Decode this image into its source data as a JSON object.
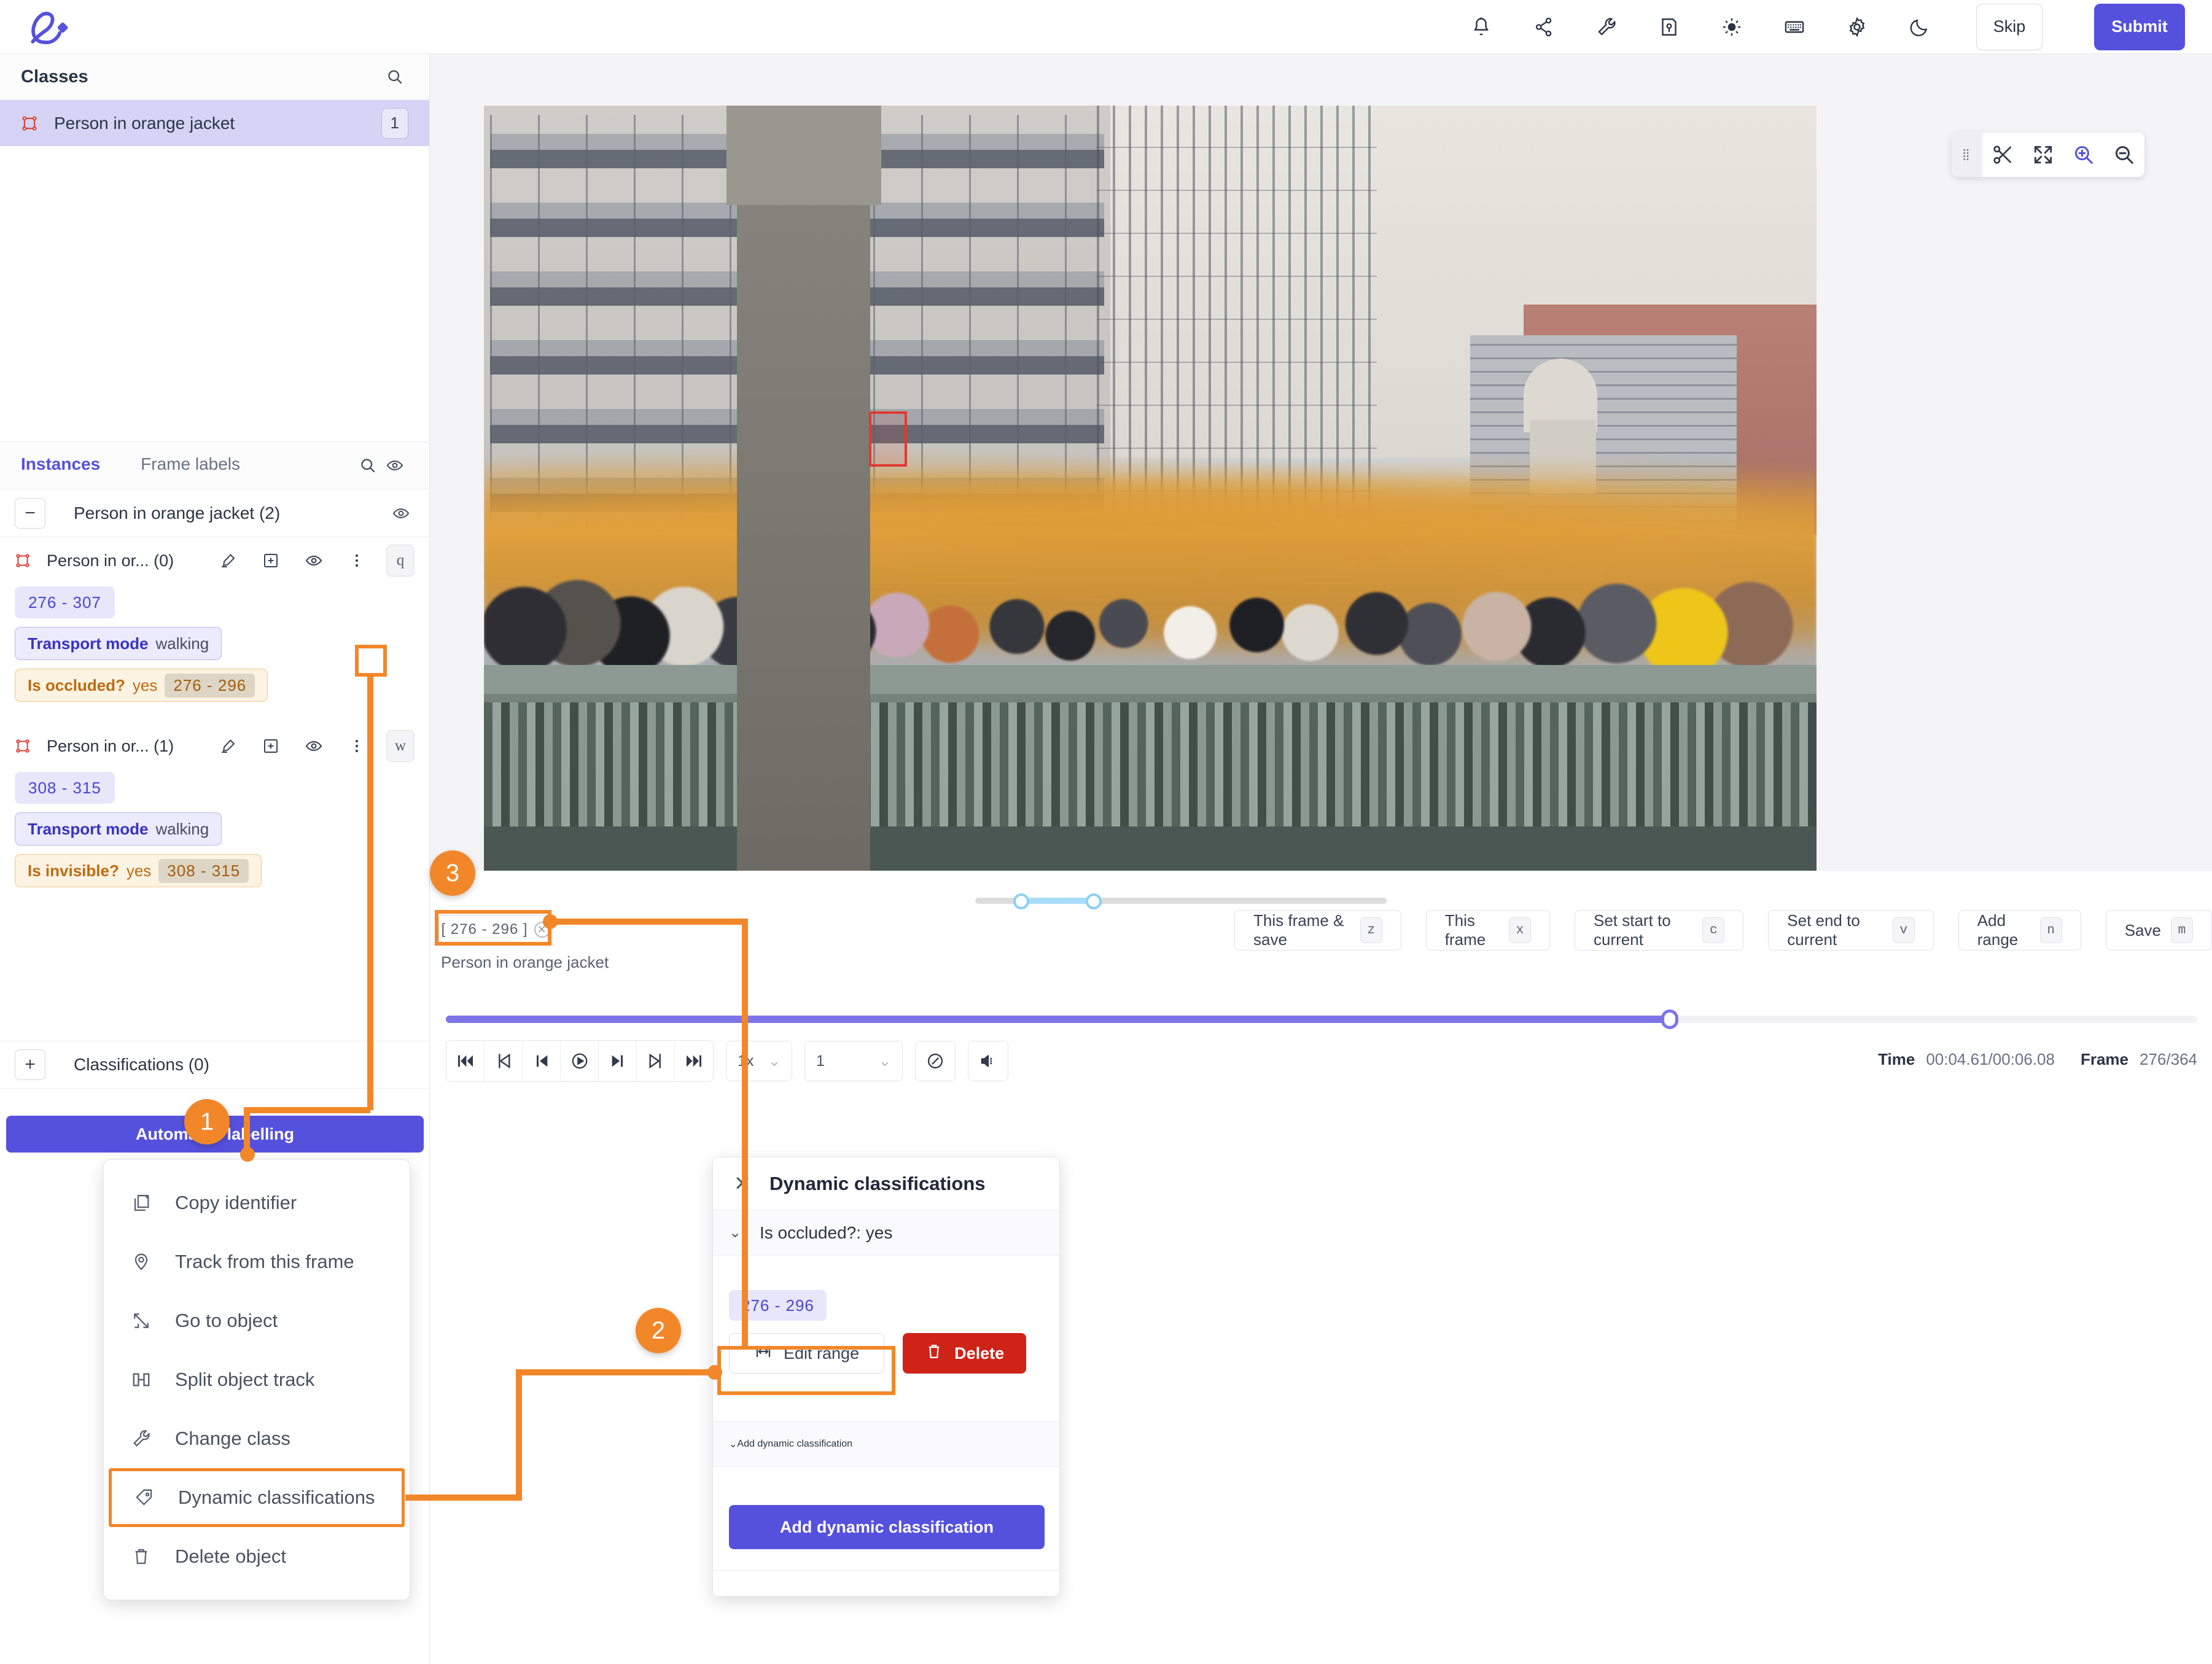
{
  "header": {
    "logo_name": "encord-logo",
    "icons": [
      {
        "name": "bell-icon",
        "label": "Notifications"
      },
      {
        "name": "share-icon",
        "label": "Share"
      },
      {
        "name": "wrench-icon",
        "label": "Tools"
      },
      {
        "name": "save-file-icon",
        "label": "Save"
      },
      {
        "name": "brightness-icon",
        "label": "Brightness"
      },
      {
        "name": "keyboard-icon",
        "label": "Keyboard shortcuts"
      },
      {
        "name": "gear-icon",
        "label": "Settings"
      },
      {
        "name": "moon-icon",
        "label": "Dark mode"
      }
    ],
    "skip_label": "Skip",
    "submit_label": "Submit"
  },
  "sidebar": {
    "classes_title": "Classes",
    "search_icon": "search-icon",
    "classes": [
      {
        "name": "Person in orange jacket",
        "count": "1"
      }
    ],
    "tabs": [
      {
        "label": "Instances",
        "active": true
      },
      {
        "label": "Frame labels",
        "active": false
      }
    ],
    "group": {
      "label": "Person in orange jacket (2)"
    },
    "instances": [
      {
        "name": "Person in or... (0)",
        "shortcut": "q",
        "range": "276  -  307",
        "attr1_key": "Transport mode",
        "attr1_val": "walking",
        "attr2_key": "Is occluded?",
        "attr2_val": "yes",
        "attr2_range": "276  -  296"
      },
      {
        "name": "Person in or... (1)",
        "shortcut": "w",
        "range": "308  -  315",
        "attr1_key": "Transport mode",
        "attr1_val": "walking",
        "attr2_key": "Is invisible?",
        "attr2_val": "yes",
        "attr2_range": "308  -  315"
      }
    ],
    "classifications_label": "Classifications (0)",
    "automated_labelling_label": "Automated labelling"
  },
  "canvas": {
    "toolbar": [
      {
        "name": "drag-handle-icon",
        "label": "Move toolbar"
      },
      {
        "name": "scissors-icon",
        "label": "Cut"
      },
      {
        "name": "fit-screen-icon",
        "label": "Fit to screen"
      },
      {
        "name": "zoom-in-icon",
        "label": "Zoom in"
      },
      {
        "name": "zoom-out-icon",
        "label": "Zoom out"
      }
    ],
    "bbox_label": "Person in orange jacket"
  },
  "timeline": {
    "frame_range_tag": "[ 276   -  296 ]",
    "tag_object_name": "Person in orange jacket",
    "buttons": [
      {
        "label": "This frame & save",
        "key": "z"
      },
      {
        "label": "This frame",
        "key": "x"
      },
      {
        "label": "Set start to current",
        "key": "c"
      },
      {
        "label": "Set end to current",
        "key": "v"
      },
      {
        "label": "Add range",
        "key": "n"
      },
      {
        "label": "Save",
        "key": "m"
      }
    ],
    "playback": [
      {
        "name": "skip-to-start-icon"
      },
      {
        "name": "previous-keyframe-icon"
      },
      {
        "name": "previous-frame-icon"
      },
      {
        "name": "play-icon"
      },
      {
        "name": "next-frame-icon"
      },
      {
        "name": "next-keyframe-icon"
      },
      {
        "name": "skip-to-end-icon"
      }
    ],
    "speed_value": "1x",
    "step_value": "1",
    "compass_icon": "compass-icon",
    "volume_icon": "volume-icon",
    "time_label": "Time",
    "time_value": "00:04.61/00:06.08",
    "frame_label": "Frame",
    "frame_value": "276/364"
  },
  "context_menu": {
    "items": [
      {
        "label": "Copy identifier",
        "icon": "copy-icon",
        "highlighted": false
      },
      {
        "label": "Track from this frame",
        "icon": "track-icon",
        "highlighted": false
      },
      {
        "label": "Go to object",
        "icon": "goto-object-icon",
        "highlighted": false
      },
      {
        "label": "Split object track",
        "icon": "split-track-icon",
        "highlighted": false
      },
      {
        "label": "Change class",
        "icon": "wrench-icon",
        "highlighted": false
      },
      {
        "label": "Dynamic classifications",
        "icon": "tag-icon",
        "highlighted": true
      },
      {
        "label": "Delete object",
        "icon": "trash-icon",
        "highlighted": false
      }
    ]
  },
  "dynamic_panel": {
    "title": "Dynamic classifications",
    "close_icon": "close-icon",
    "section_label": "Is occluded?: yes",
    "range_value": "276  -  296",
    "edit_range_label": "Edit range",
    "delete_label": "Delete",
    "add_section_label": "Add dynamic classification",
    "add_button_label": "Add dynamic classification"
  },
  "annotations": {
    "badges": [
      {
        "number": "1"
      },
      {
        "number": "2"
      },
      {
        "number": "3"
      }
    ],
    "accent_color": "#f2872a"
  },
  "colors": {
    "primary": "#5551dd",
    "accent_orange": "#f2872a",
    "danger": "#cf2318",
    "class_red": "#e03a2f",
    "chip_blue": "#e7e6fb"
  }
}
